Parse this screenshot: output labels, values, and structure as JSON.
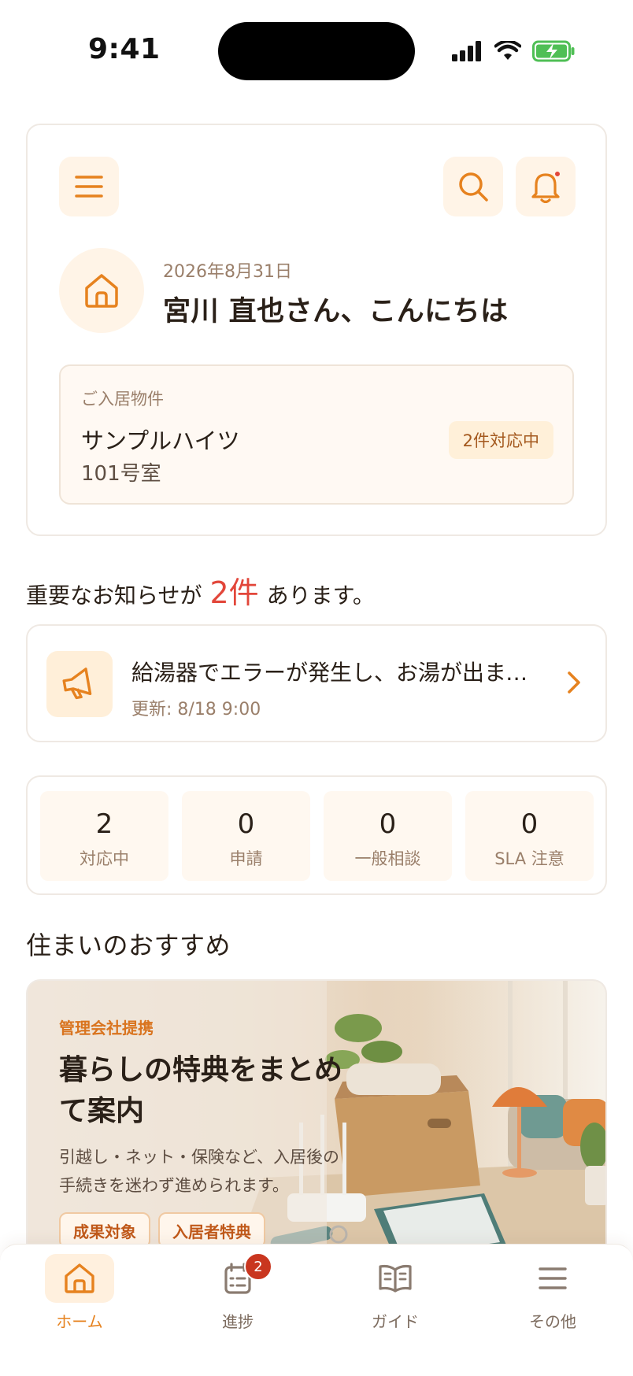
{
  "status_bar": {
    "time": "9:41"
  },
  "header": {
    "date": "2026年8月31日",
    "greeting": "宮川 直也さん、こんにちは",
    "property_label": "ご入居物件",
    "property_name": "サンプルハイツ",
    "room": "101号室",
    "status_chip": "2件対応中"
  },
  "notices": {
    "prefix": "重要なお知らせが",
    "count": "2件",
    "suffix": "あります。",
    "item_title": "給湯器でエラーが発生し、お湯が出ません",
    "item_updated": "更新: 8/18 9:00"
  },
  "stats": [
    {
      "value": "2",
      "label": "対応中"
    },
    {
      "value": "0",
      "label": "申請"
    },
    {
      "value": "0",
      "label": "一般相談"
    },
    {
      "value": "0",
      "label": "SLA 注意"
    }
  ],
  "recommend": {
    "section_title": "住まいのおすすめ",
    "tag": "管理会社提携",
    "title": "暮らしの特典をまとめて案内",
    "description": "引越し・ネット・保険など、入居後の手続きを迷わず進められます。",
    "chips": [
      "成果対象",
      "入居者特典"
    ]
  },
  "tab_bar": {
    "tabs": [
      {
        "label": "ホーム",
        "icon": "home-icon",
        "active": true
      },
      {
        "label": "進捗",
        "icon": "clipboard-icon",
        "badge": "2"
      },
      {
        "label": "ガイド",
        "icon": "book-icon"
      },
      {
        "label": "その他",
        "icon": "menu-icon"
      }
    ]
  },
  "colors": {
    "accent": "#E6821F",
    "alert": "#E2463A",
    "surface": "#FFF4E7"
  }
}
